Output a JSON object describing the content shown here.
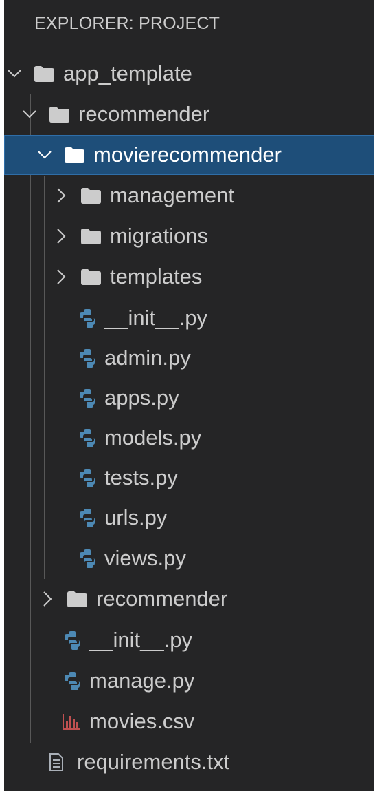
{
  "explorer": {
    "title": "EXPLORER: PROJECT"
  },
  "tree": {
    "app_template": {
      "label": "app_template",
      "icon": "folder-icon",
      "expanded": true
    },
    "recommender_outer": {
      "label": "recommender",
      "icon": "folder-icon",
      "expanded": true
    },
    "movierecommender": {
      "label": "movierecommender",
      "icon": "folder-icon",
      "expanded": true,
      "selected": true
    },
    "management": {
      "label": "management",
      "icon": "folder-icon",
      "expanded": false
    },
    "migrations": {
      "label": "migrations",
      "icon": "folder-icon",
      "expanded": false
    },
    "templates": {
      "label": "templates",
      "icon": "folder-icon",
      "expanded": false
    },
    "mr_init": {
      "label": "__init__.py",
      "icon": "python-icon"
    },
    "admin": {
      "label": "admin.py",
      "icon": "python-icon"
    },
    "apps": {
      "label": "apps.py",
      "icon": "python-icon"
    },
    "models": {
      "label": "models.py",
      "icon": "python-icon"
    },
    "tests": {
      "label": "tests.py",
      "icon": "python-icon"
    },
    "urls": {
      "label": "urls.py",
      "icon": "python-icon"
    },
    "views": {
      "label": "views.py",
      "icon": "python-icon"
    },
    "recommender_inner": {
      "label": "recommender",
      "icon": "folder-icon",
      "expanded": false
    },
    "rec_init": {
      "label": "__init__.py",
      "icon": "python-icon"
    },
    "manage": {
      "label": "manage.py",
      "icon": "python-icon"
    },
    "movies_csv": {
      "label": "movies.csv",
      "icon": "csv-icon"
    },
    "requirements": {
      "label": "requirements.txt",
      "icon": "text-file-icon"
    }
  },
  "colors": {
    "panel_background": "#252526",
    "selection_background": "#1e4e79",
    "text": "#cccccc",
    "folder": "#cccccc",
    "python_icon": "#4d89b4",
    "csv_icon": "#c05050",
    "text_file_icon": "#aab0b8"
  }
}
